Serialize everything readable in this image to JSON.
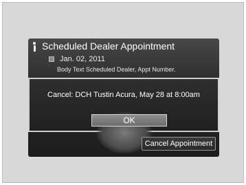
{
  "screen": {
    "title": "Scheduled Dealer Appointment",
    "date": "Jan. 02, 2011",
    "body_text": "Body Text Scheduled Dealer, Appt Number."
  },
  "dialog": {
    "message": "Cancel: DCH Tustin Acura, May 28 at 8:00am",
    "ok_label": "OK"
  },
  "actions": {
    "cancel_label": "Cancel Appointment"
  },
  "icons": {
    "info": "info-icon",
    "calendar": "calendar-icon"
  }
}
